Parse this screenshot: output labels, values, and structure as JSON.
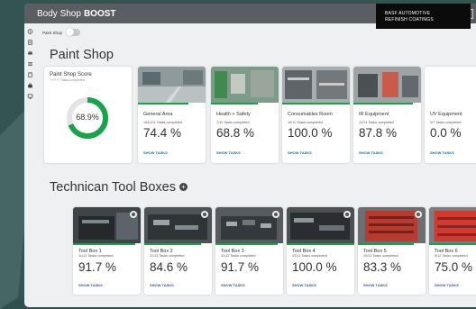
{
  "app": {
    "title_prefix": "Body Shop",
    "title_bold": "BOOST"
  },
  "brand": {
    "line1": "BASF AUTOMOTIVE",
    "line2": "REFINISH COATINGS"
  },
  "lang": "EN",
  "toggle": {
    "label": "Paint Shop"
  },
  "paint_shop": {
    "title": "Paint Shop",
    "score": {
      "title": "Paint Shop Score",
      "subtitle": "??/??? Tasks completed",
      "value": "68.9%",
      "fraction": 0.689
    },
    "areas": [
      {
        "name": "General Area",
        "tasks": "104/101 Tasks completed",
        "pct": "74.4 %",
        "link": "SHOW TASKS",
        "progress": 0.744
      },
      {
        "name": "Health + Safety",
        "tasks": "7/10 Tasks completed",
        "pct": "68.8 %",
        "link": "SHOW TASKS",
        "progress": 0.688
      },
      {
        "name": "Consumables Room",
        "tasks": "10/10 Tasks completed",
        "pct": "100.0 %",
        "link": "SHOW TASKS",
        "progress": 1.0
      },
      {
        "name": "IR Equipment",
        "tasks": "12/14 Tasks completed",
        "pct": "87.8 %",
        "link": "SHOW TASKS",
        "progress": 0.878
      },
      {
        "name": "UV Equipment",
        "tasks": "0/7 Tasks completed",
        "pct": "0.0 %",
        "link": "SHOW TASKS",
        "progress": 0.0
      }
    ]
  },
  "tool_boxes": {
    "title": "Technican Tool Boxes",
    "items": [
      {
        "name": "Tool Box 1",
        "tasks": "11/12 Tasks completed",
        "pct": "91.7 %",
        "link": "SHOW TASKS",
        "progress": 0.917
      },
      {
        "name": "Tool Box 2",
        "tasks": "11/13 Tasks completed",
        "pct": "84.6 %",
        "link": "SHOW TASKS",
        "progress": 0.846
      },
      {
        "name": "Tool Box 3",
        "tasks": "11/12 Tasks completed",
        "pct": "91.7 %",
        "link": "SHOW TASKS",
        "progress": 0.917
      },
      {
        "name": "Tool Box 4",
        "tasks": "12/12 Tasks completed",
        "pct": "100.0 %",
        "link": "SHOW TASKS",
        "progress": 1.0
      },
      {
        "name": "Tool Box 5",
        "tasks": "10/12 Tasks completed",
        "pct": "83.3 %",
        "link": "SHOW TASKS",
        "progress": 0.833
      },
      {
        "name": "Tool Box 6",
        "tasks": "9/12 Tasks completed",
        "pct": "75.0 %",
        "link": "SHOW TASKS",
        "progress": 0.75
      }
    ]
  },
  "colors": {
    "accent": "#17a34a",
    "link": "#2b5fb0",
    "titlebar": "#5a5e62"
  },
  "sidebar_icons": [
    "info-icon",
    "document-icon",
    "car-icon",
    "list-icon",
    "clipboard-icon",
    "toolbox-icon",
    "monitor-icon"
  ]
}
